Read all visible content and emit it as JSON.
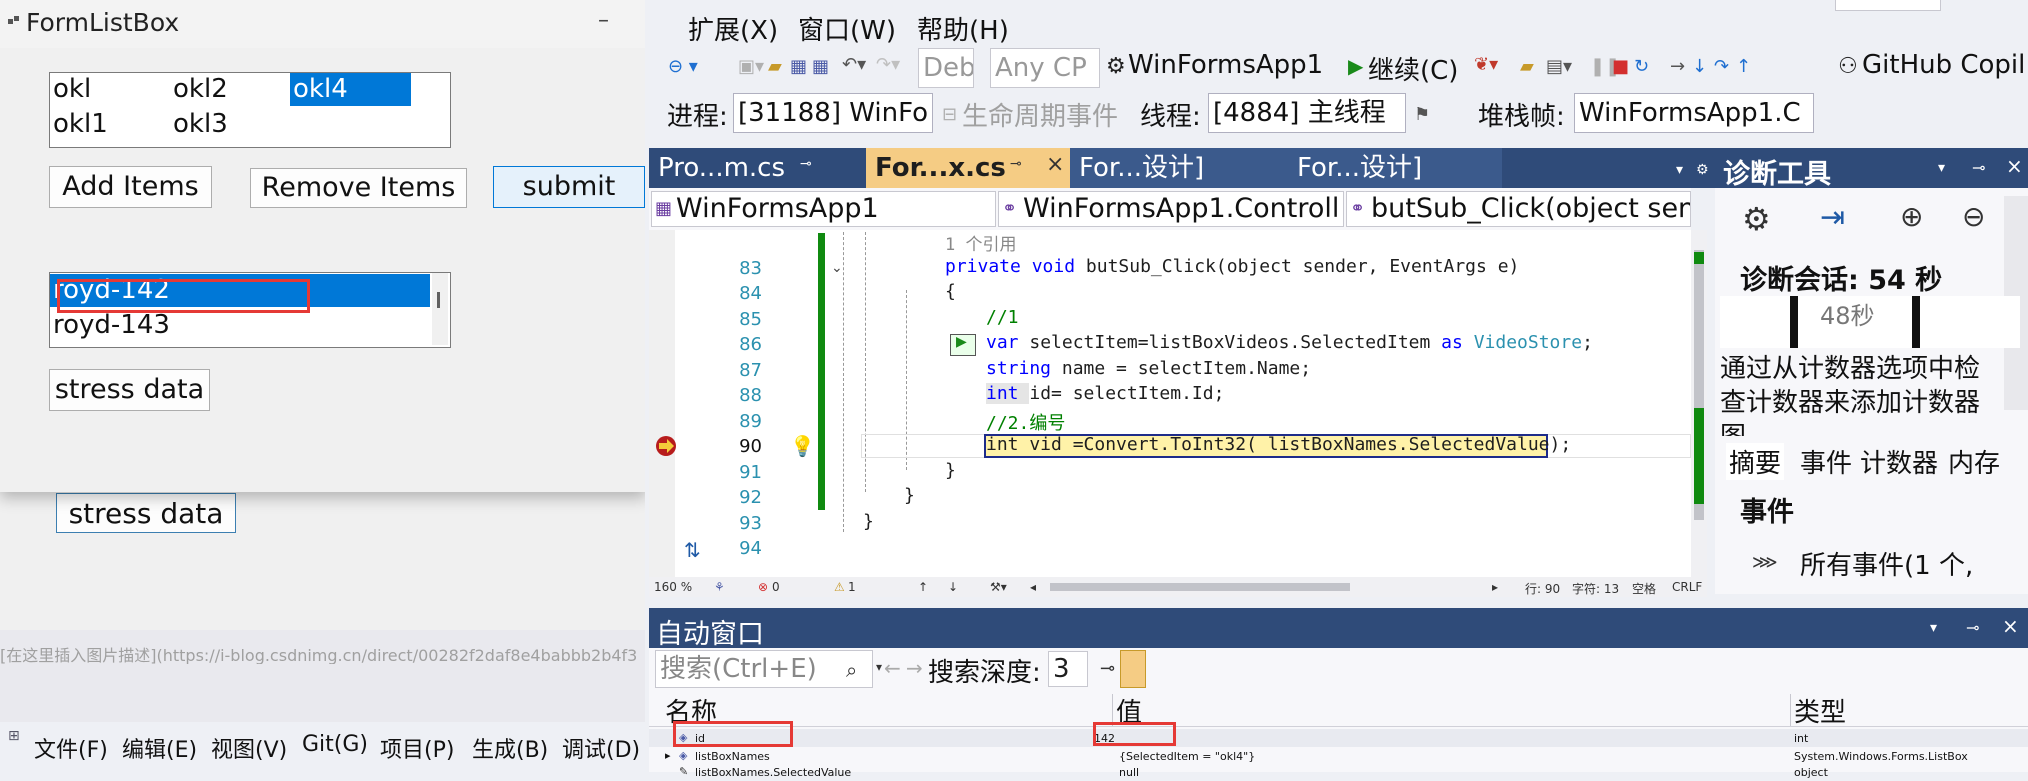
{
  "background_app": {
    "form_button": "stress data",
    "caption_text": "[在这里插入图片描述](https://i-blog.csdnimg.cn/direct/00282f2daf8e4babbb2b4f3",
    "menu": [
      "文件(F)",
      "编辑(E)",
      "视图(V)",
      "Git(G)",
      "项目(P)",
      "生成(B)",
      "调试(D)"
    ]
  },
  "form": {
    "title": "FormListBox",
    "minimize": "–",
    "listbox1": {
      "items": [
        "okl",
        "okl1",
        "okl2",
        "okl3",
        "okl4"
      ],
      "selected": "okl4"
    },
    "buttons": {
      "add": "Add Items",
      "remove": "Remove Items",
      "submit": "submit",
      "stress": "stress data"
    },
    "listbox2": {
      "items": [
        "royd-142",
        "royd-143"
      ],
      "selected": "royd-142"
    }
  },
  "vs": {
    "menu": [
      "扩展(X)",
      "窗口(W)",
      "帮助(H)"
    ],
    "toolbar": {
      "config": "Deb",
      "platform": "Any CP",
      "startup": "WinFormsApp1",
      "continue": "继续(C)",
      "copilot": "GitHub Copil"
    },
    "debug_bar": {
      "process_label": "进程:",
      "process_value": "[31188] WinFo",
      "lifecycle": "生命周期事件",
      "thread_label": "线程:",
      "thread_value": "[4884] 主线程",
      "stack_label": "堆栈帧:",
      "stack_value": "WinFormsApp1.C"
    },
    "tabs": [
      "Pro...m.cs",
      "For...x.cs",
      "For...设计]",
      "For...设计]"
    ],
    "nav": [
      "WinFormsApp1",
      "WinFormsApp1.Controll",
      "butSub_Click(object sen"
    ],
    "code": {
      "ref_hint": "1 个引用",
      "line_numbers": [
        "83",
        "84",
        "85",
        "86",
        "87",
        "88",
        "89",
        "90",
        "91",
        "92",
        "93",
        "94"
      ],
      "l83_kw": "private void ",
      "l83_rest": "butSub_Click(object sender, EventArgs e)",
      "l84": "{",
      "l85": "//1",
      "l86_kw": "var ",
      "l86_mid": "selectItem=listBoxVideos.SelectedItem ",
      "l86_as": "as ",
      "l86_ty": "VideoStore",
      "l86_end": ";",
      "l87_kw": "string ",
      "l87_rest": "name = selectItem.Name;",
      "l88_kw": "int ",
      "l88_rest": "id= selectItem.Id;",
      "l89": "//2.编号",
      "l90": "int vid =Convert.ToInt32( listBoxNames.SelectedValue);",
      "l91": "}",
      "l92": "}",
      "l93": "}"
    },
    "status": {
      "zoom": "160 %",
      "errors": "0",
      "warnings": "1",
      "line": "行: 90",
      "char": "字符: 13",
      "spaces": "空格",
      "eol": "CRLF"
    },
    "diagnostics": {
      "title": "诊断工具",
      "session": "诊断会话: 54 秒",
      "graph_label": "48秒",
      "description": "通过从计数器选项中检查计数器来添加计数器图",
      "tabs": [
        "摘要",
        "事件",
        "计数器",
        "内存"
      ],
      "events_header": "事件",
      "all_events": "所有事件(1 个,"
    },
    "autos": {
      "title": "自动窗口",
      "search_placeholder": "搜索(Ctrl+E)",
      "depth_label": "搜索深度:",
      "depth_value": "3",
      "headers": [
        "名称",
        "值",
        "类型"
      ],
      "rows": [
        {
          "name": "id",
          "value": "142",
          "type": "int"
        },
        {
          "name": "listBoxNames",
          "value": "{SelectedItem = \"okl4\"}",
          "type": "System.Windows.Forms.ListBox"
        },
        {
          "name": "listBoxNames.SelectedValue",
          "value": "null",
          "type": "object"
        }
      ]
    }
  }
}
